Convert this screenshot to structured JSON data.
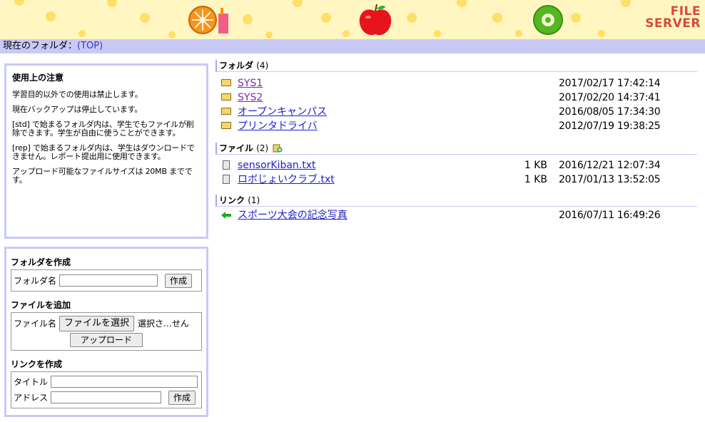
{
  "banner": {
    "logo_line1": "FILE",
    "logo_line2": "SERVER"
  },
  "breadcrumb": {
    "label": "現在のフォルダ：",
    "current": "(TOP)"
  },
  "notice": {
    "title": "使用上の注意",
    "lines": [
      "学習目的以外での使用は禁止します。",
      "現在バックアップは停止しています。",
      "[std] で始まるフォルダ内は、学生でもファイルが削除できます。学生が自由に使うことができます。",
      "[rep] で始まるフォルダ内は、学生はダウンロードできません。レポート提出用に使用できます。",
      "アップロード可能なファイルサイズは 20MB までです。"
    ]
  },
  "create_folder": {
    "title": "フォルダを作成",
    "name_label": "フォルダ名",
    "button": "作成",
    "name_value": ""
  },
  "add_file": {
    "title": "ファイルを追加",
    "name_label": "ファイル名",
    "choose_button": "ファイルを選択",
    "choose_status": "選択さ…せん",
    "upload_button": "アップロード"
  },
  "create_link": {
    "title": "リンクを作成",
    "title_label": "タイトル",
    "address_label": "アドレス",
    "button": "作成"
  },
  "folders": {
    "heading": "フォルダ",
    "count": "(4)",
    "items": [
      {
        "name": "SYS1",
        "date": "2017/02/17 17:42:14"
      },
      {
        "name": "SYS2",
        "date": "2017/02/20 14:37:41"
      },
      {
        "name": "オープンキャンパス",
        "date": "2016/08/05 17:34:30"
      },
      {
        "name": "プリンタドライバ",
        "date": "2012/07/19 19:38:25"
      }
    ]
  },
  "files": {
    "heading": "ファイル",
    "count": "(2)",
    "items": [
      {
        "name": "sensorKiban.txt",
        "size": "1 KB",
        "date": "2016/12/21 12:07:34"
      },
      {
        "name": "ロボじょいクラブ.txt",
        "size": "1 KB",
        "date": "2017/01/13 13:52:05"
      }
    ]
  },
  "links": {
    "heading": "リンク",
    "count": "(1)",
    "items": [
      {
        "name": "スポーツ大会の記念写真",
        "date": "2016/07/11 16:49:26"
      }
    ]
  },
  "colors": {
    "banner_bg": "#fff6c2",
    "accent": "#c9c9f6",
    "link": "#2020c8",
    "visited": "#7a2aa8",
    "logo": "#d54b3b"
  }
}
